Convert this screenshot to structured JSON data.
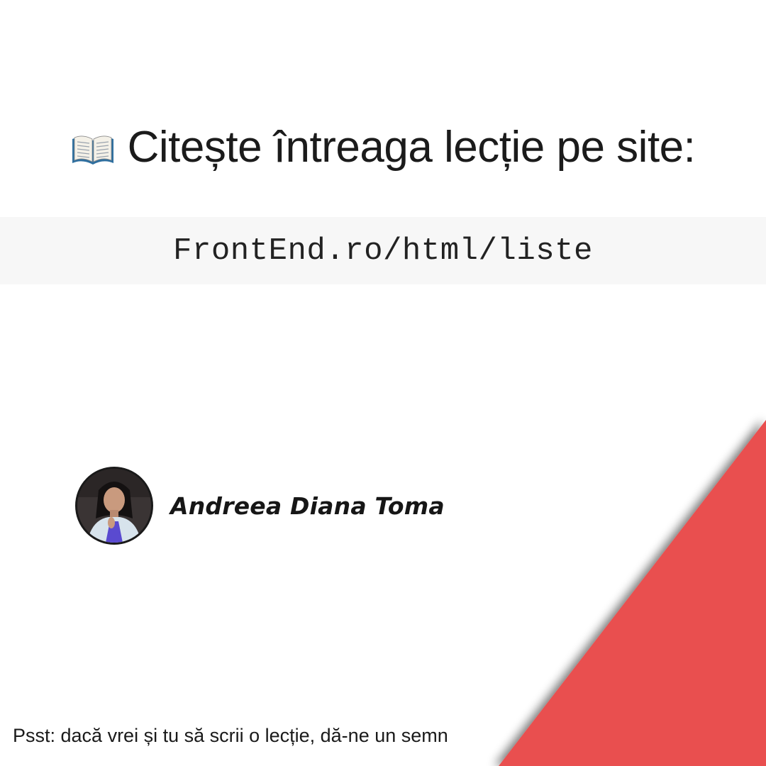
{
  "headline": {
    "icon": "open-book-icon",
    "text": "Citește întreaga lecție pe site:"
  },
  "url": {
    "text": "FrontEnd.ro/html/liste"
  },
  "author": {
    "name": "Andreea Diana Toma"
  },
  "footer": {
    "note": "Psst: dacă vrei și tu să scrii o lecție, dă-ne un semn"
  },
  "colors": {
    "accent": "#e94f4f",
    "url_band": "#f7f7f7",
    "text": "#1b1b1b"
  }
}
